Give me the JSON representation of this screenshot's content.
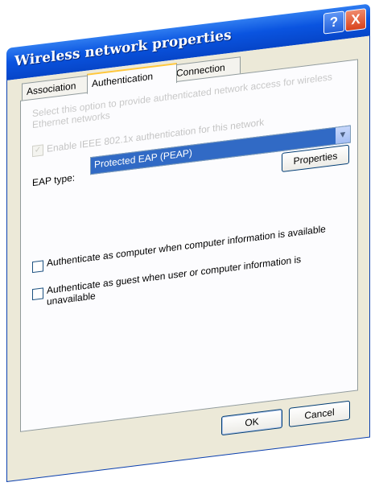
{
  "window": {
    "title": "Wireless network properties",
    "help_label": "?",
    "close_label": "X"
  },
  "tabs": [
    {
      "label": "Association",
      "active": false
    },
    {
      "label": "Authentication",
      "active": true
    },
    {
      "label": "Connection",
      "active": false
    }
  ],
  "authentication": {
    "description": "Select this option to provide authenticated network access for wireless Ethernet networks",
    "enable_8021x_label": "Enable IEEE 802.1x authentication for this network",
    "enable_8021x_checked": true,
    "enable_8021x_enabled": false,
    "eap_type_label": "EAP type:",
    "eap_type_value": "Protected EAP (PEAP)",
    "properties_label": "Properties",
    "auth_as_computer_label": "Authenticate as computer when computer information is available",
    "auth_as_computer_checked": false,
    "auth_as_guest_label": "Authenticate as guest when user or computer information is unavailable",
    "auth_as_guest_checked": false
  },
  "footer": {
    "ok_label": "OK",
    "cancel_label": "Cancel"
  },
  "colors": {
    "titlebar": "#0a54e0",
    "selection": "#316ac5",
    "dialog_bg": "#ece9d8",
    "active_tab_accent": "#ffc73c",
    "close_button": "#d8421c"
  },
  "icons": {
    "help": "help-icon",
    "close": "close-icon",
    "dropdown": "chevron-down-icon",
    "check": "checkmark-icon"
  }
}
